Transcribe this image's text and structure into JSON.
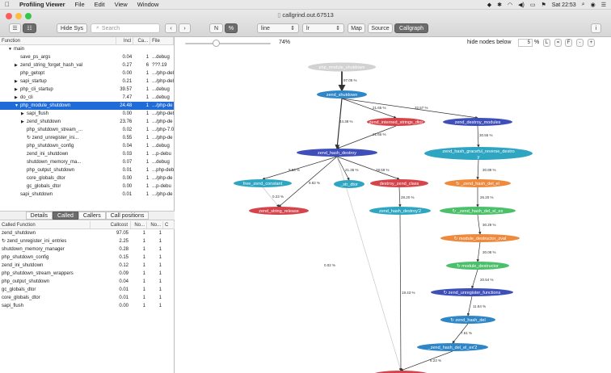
{
  "menubar": {
    "app_name": "Profiling Viewer",
    "menus": [
      "File",
      "Edit",
      "View",
      "Window"
    ],
    "clock": "Sat 22:53"
  },
  "window": {
    "title": "callgrind.out.67513"
  },
  "toolbar": {
    "hide_sys": "Hide Sys",
    "search_placeholder": "Search",
    "n_label": "N",
    "pct_label": "%",
    "style_select": "line",
    "dir_select": "lr",
    "map_label": "Map",
    "source_label": "Source",
    "callgraph_label": "Callgraph",
    "info_label": "i"
  },
  "upper_table": {
    "headers": [
      "Function",
      "Incl",
      "Ca...",
      "File"
    ],
    "rows": [
      {
        "indent": 1,
        "arrow": "▼",
        "name": "main",
        "incl": "",
        "ca": "",
        "file": "",
        "selected": false
      },
      {
        "indent": 2,
        "arrow": "",
        "name": "save_ps_args",
        "incl": "0.04",
        "ca": "1",
        "file": "...debug",
        "selected": false
      },
      {
        "indent": 2,
        "arrow": "▶",
        "name": "zend_string_forget_hash_val",
        "incl": "0.27",
        "ca": "6",
        "file": "???.19",
        "selected": false
      },
      {
        "indent": 2,
        "arrow": "",
        "name": "php_getopt",
        "incl": "0.00",
        "ca": "1",
        "file": ".../php-debu",
        "selected": false
      },
      {
        "indent": 2,
        "arrow": "▶",
        "name": "sapi_startup",
        "incl": "0.21",
        "ca": "1",
        "file": ".../php-debu",
        "selected": false
      },
      {
        "indent": 2,
        "arrow": "▶",
        "name": "php_cli_startup",
        "incl": "39.57",
        "ca": "1",
        "file": "...debug",
        "selected": false
      },
      {
        "indent": 2,
        "arrow": "▶",
        "name": "do_cli",
        "incl": "7.47",
        "ca": "1",
        "file": "...debug",
        "selected": false
      },
      {
        "indent": 2,
        "arrow": "▼",
        "name": "php_module_shutdown",
        "incl": "24.48",
        "ca": "1",
        "file": ".../php-de",
        "selected": true
      },
      {
        "indent": 3,
        "arrow": "▶",
        "name": "sapi_flush",
        "incl": "0.00",
        "ca": "1",
        "file": ".../php-debu",
        "selected": false
      },
      {
        "indent": 3,
        "arrow": "▶",
        "name": "zend_shutdown",
        "incl": "23.76",
        "ca": "1",
        "file": ".../php-de",
        "selected": false
      },
      {
        "indent": 3,
        "arrow": "",
        "name": "php_shutdown_stream_...",
        "incl": "0.02",
        "ca": "1",
        "file": ".../php-7.0",
        "selected": false
      },
      {
        "indent": 3,
        "arrow": "",
        "name": "↻ zend_unregister_ini...",
        "incl": "0.55",
        "ca": "1",
        "file": ".../php-de",
        "selected": false
      },
      {
        "indent": 3,
        "arrow": "",
        "name": "php_shutdown_config",
        "incl": "0.04",
        "ca": "1",
        "file": "...debug",
        "selected": false
      },
      {
        "indent": 3,
        "arrow": "",
        "name": "zend_ini_shutdown",
        "incl": "0.03",
        "ca": "1",
        "file": "...p-debu",
        "selected": false
      },
      {
        "indent": 3,
        "arrow": "",
        "name": "shutdown_memory_ma...",
        "incl": "0.07",
        "ca": "1",
        "file": "...debug",
        "selected": false
      },
      {
        "indent": 3,
        "arrow": "",
        "name": "php_output_shutdown",
        "incl": "0.01",
        "ca": "1",
        "file": "...php-deb",
        "selected": false
      },
      {
        "indent": 3,
        "arrow": "",
        "name": "core_globals_dtor",
        "incl": "0.00",
        "ca": "1",
        "file": ".../php-de",
        "selected": false
      },
      {
        "indent": 3,
        "arrow": "",
        "name": "gc_globals_dtor",
        "incl": "0.00",
        "ca": "1",
        "file": "...p-debu",
        "selected": false
      },
      {
        "indent": 2,
        "arrow": "",
        "name": "sapi_shutdown",
        "incl": "0.01",
        "ca": "1",
        "file": ".../php-de",
        "selected": false
      }
    ]
  },
  "tabs": [
    "Details",
    "Called",
    "Callers",
    "Call positions"
  ],
  "lower_table": {
    "headers": [
      "Called Function",
      "Callcost",
      "No...",
      "No...",
      "C"
    ],
    "rows": [
      [
        "zend_shutdown",
        "97.05",
        "1",
        "1"
      ],
      [
        "↻ zend_unregister_ini_entries",
        "2.25",
        "1",
        "1"
      ],
      [
        "shutdown_memory_manager",
        "0.28",
        "1",
        "1"
      ],
      [
        "php_shutdown_config",
        "0.15",
        "1",
        "1"
      ],
      [
        "zend_ini_shutdown",
        "0.12",
        "1",
        "1"
      ],
      [
        "php_shutdown_stream_wrappers",
        "0.09",
        "1",
        "1"
      ],
      [
        "php_output_shutdown",
        "0.04",
        "1",
        "1"
      ],
      [
        "gc_globals_dtor",
        "0.01",
        "1",
        "1"
      ],
      [
        "core_globals_dtor",
        "0.01",
        "1",
        "1"
      ],
      [
        "sapi_flush",
        "0.00",
        "1",
        "1"
      ]
    ]
  },
  "graph": {
    "zoom": "74%",
    "hide_label": "hide nodes below",
    "hide_value": "5",
    "hide_unit": "%",
    "buttons": [
      "L",
      "=",
      "F",
      "-",
      "+"
    ],
    "colors": {
      "blue": "#2f86c6",
      "teal": "#2ea6c2",
      "red": "#d4444a",
      "indigo": "#3f4fba",
      "orange": "#ee8a3d",
      "green": "#4cbf6a",
      "gray": "#d2d2d2"
    },
    "nodes": [
      {
        "id": "php_module_shutdown",
        "label": "php_module_shutdown",
        "color": "gray"
      },
      {
        "id": "zend_shutdown",
        "label": "zend_shutdown",
        "color": "blue"
      },
      {
        "id": "zend_interned_strings_dtor",
        "label": "zend_interned_strings_dtor",
        "color": "red"
      },
      {
        "id": "zend_destroy_modules",
        "label": "zend_destroy_modules",
        "color": "indigo"
      },
      {
        "id": "zend_hash_destroy",
        "label": "zend_hash_destroy",
        "color": "indigo"
      },
      {
        "id": "zend_hash_graceful_reverse_destroy",
        "label": "zend_hash_graceful_reverse_destro y",
        "color": "teal"
      },
      {
        "id": "free_zend_constant",
        "label": "free_zend_constant",
        "color": "teal"
      },
      {
        "id": "_str_dtor",
        "label": "_str_dtor",
        "color": "teal"
      },
      {
        "id": "destroy_zend_class",
        "label": "destroy_zend_class",
        "color": "red"
      },
      {
        "id": "_zend_hash_del_el",
        "label": "↻ _zend_hash_del_el",
        "color": "orange"
      },
      {
        "id": "zend_string_release",
        "label": "zend_string_release",
        "color": "red"
      },
      {
        "id": "zend_hash_destroy2",
        "label": "zend_hash_destroy'2",
        "color": "teal"
      },
      {
        "id": "_zend_hash_del_el_ex",
        "label": "↻ _zend_hash_del_el_ex",
        "color": "green"
      },
      {
        "id": "module_destructor_zval",
        "label": "↻ module_destructor_zval",
        "color": "orange"
      },
      {
        "id": "module_destructor",
        "label": "↻ module_destructor",
        "color": "green"
      },
      {
        "id": "zend_unregister_functions",
        "label": "↻ zend_unregister_functions",
        "color": "indigo"
      },
      {
        "id": "zend_hash_del",
        "label": "↻ zend_hash_del",
        "color": "blue"
      },
      {
        "id": "_zend_hash_del_el_ex2",
        "label": "_zend_hash_del_el_ex'2",
        "color": "blue"
      },
      {
        "id": "zend_function_dtor",
        "label": "zend_function_dtor",
        "color": "red"
      }
    ],
    "edges": [
      {
        "from": "php_module_shutdown",
        "to": "zend_shutdown",
        "label": "97.05 %"
      },
      {
        "from": "zend_shutdown",
        "to": "zend_interned_strings_dtor",
        "label": "21.65 %"
      },
      {
        "from": "zend_shutdown",
        "to": "zend_destroy_modules",
        "label": "32.57 %"
      },
      {
        "from": "zend_shutdown",
        "to": "zend_hash_destroy",
        "label": "44.38 %"
      },
      {
        "from": "zend_interned_strings_dtor",
        "to": "zend_hash_destroy",
        "label": "21.65 %"
      },
      {
        "from": "zend_destroy_modules",
        "to": "zend_hash_graceful_reverse_destroy",
        "label": "30.55 %"
      },
      {
        "from": "zend_hash_destroy",
        "to": "free_zend_constant",
        "label": "9.56 %"
      },
      {
        "from": "zend_hash_destroy",
        "to": "zend_string_release",
        "label": "9.62 %"
      },
      {
        "from": "zend_hash_destroy",
        "to": "_str_dtor",
        "label": "21.36 %"
      },
      {
        "from": "zend_hash_destroy",
        "to": "destroy_zend_class",
        "label": "28.59 %"
      },
      {
        "from": "zend_hash_destroy",
        "to": "zend_function_dtor",
        "label": "0.02 %"
      },
      {
        "from": "free_zend_constant",
        "to": "zend_string_release",
        "label": "0.23 %"
      },
      {
        "from": "destroy_zend_class",
        "to": "zend_hash_destroy2",
        "label": "28.20 %"
      },
      {
        "from": "zend_hash_destroy2",
        "to": "zend_function_dtor",
        "label": "19.43 %"
      },
      {
        "from": "zend_hash_graceful_reverse_destroy",
        "to": "_zend_hash_del_el",
        "label": "30.89 %"
      },
      {
        "from": "_zend_hash_del_el",
        "to": "_zend_hash_del_el_ex",
        "label": "26.20 %"
      },
      {
        "from": "_zend_hash_del_el_ex",
        "to": "module_destructor_zval",
        "label": "30.29 %"
      },
      {
        "from": "module_destructor_zval",
        "to": "module_destructor",
        "label": "30.08 %"
      },
      {
        "from": "module_destructor",
        "to": "zend_unregister_functions",
        "label": "20.54 %"
      },
      {
        "from": "zend_unregister_functions",
        "to": "zend_hash_del",
        "label": "11.84 %"
      },
      {
        "from": "zend_hash_del",
        "to": "_zend_hash_del_el_ex2",
        "label": "7.61 %"
      },
      {
        "from": "_zend_hash_del_el_ex2",
        "to": "zend_function_dtor",
        "label": "6.23 %"
      }
    ]
  }
}
